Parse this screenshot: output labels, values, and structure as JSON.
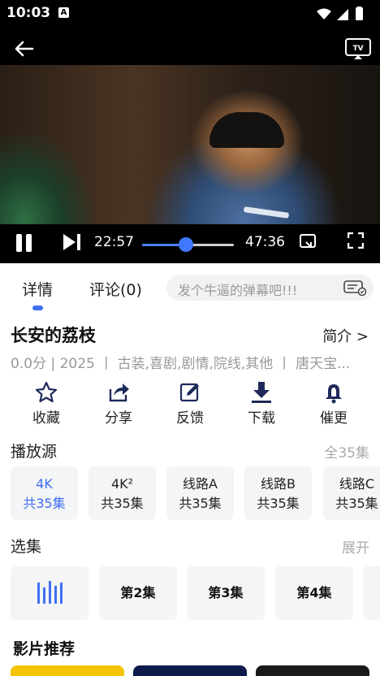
{
  "status_bar": {
    "time": "10:03",
    "notif_icon": "A"
  },
  "player": {
    "current_time": "22:57",
    "total_time": "47:36",
    "progress": 0.48
  },
  "tabs": [
    {
      "label": "详情",
      "active": true
    },
    {
      "label": "评论(0)",
      "active": false
    }
  ],
  "danmu": {
    "placeholder": "发个牛逼的弹幕吧!!!"
  },
  "details": {
    "title": "长安的荔枝",
    "intro_link": "简介 >",
    "meta": "0.0分 | 2025 丨 古装,喜剧,剧情,院线,其他 丨 唐天宝..."
  },
  "actions": [
    {
      "label": "收藏",
      "icon": "star-icon"
    },
    {
      "label": "分享",
      "icon": "share-icon"
    },
    {
      "label": "反馈",
      "icon": "edit-icon"
    },
    {
      "label": "下载",
      "icon": "download-icon"
    },
    {
      "label": "催更",
      "icon": "bell-icon"
    }
  ],
  "sources": {
    "title": "播放源",
    "more": "全35集",
    "items": [
      {
        "name": "4K",
        "count": "共35集",
        "active": true
      },
      {
        "name": "4K²",
        "count": "共35集",
        "active": false
      },
      {
        "name": "线路A",
        "count": "共35集",
        "active": false
      },
      {
        "name": "线路B",
        "count": "共35集",
        "active": false
      },
      {
        "name": "线路C",
        "count": "共35集",
        "active": false
      }
    ]
  },
  "episodes": {
    "title": "选集",
    "more": "展开",
    "items": [
      "",
      "第2集",
      "第3集",
      "第4集"
    ],
    "playing_icon": "playing-bars-icon"
  },
  "recommend": {
    "title": "影片推荐"
  },
  "colors": {
    "accent": "#3f6ff2",
    "muted": "#999999"
  }
}
